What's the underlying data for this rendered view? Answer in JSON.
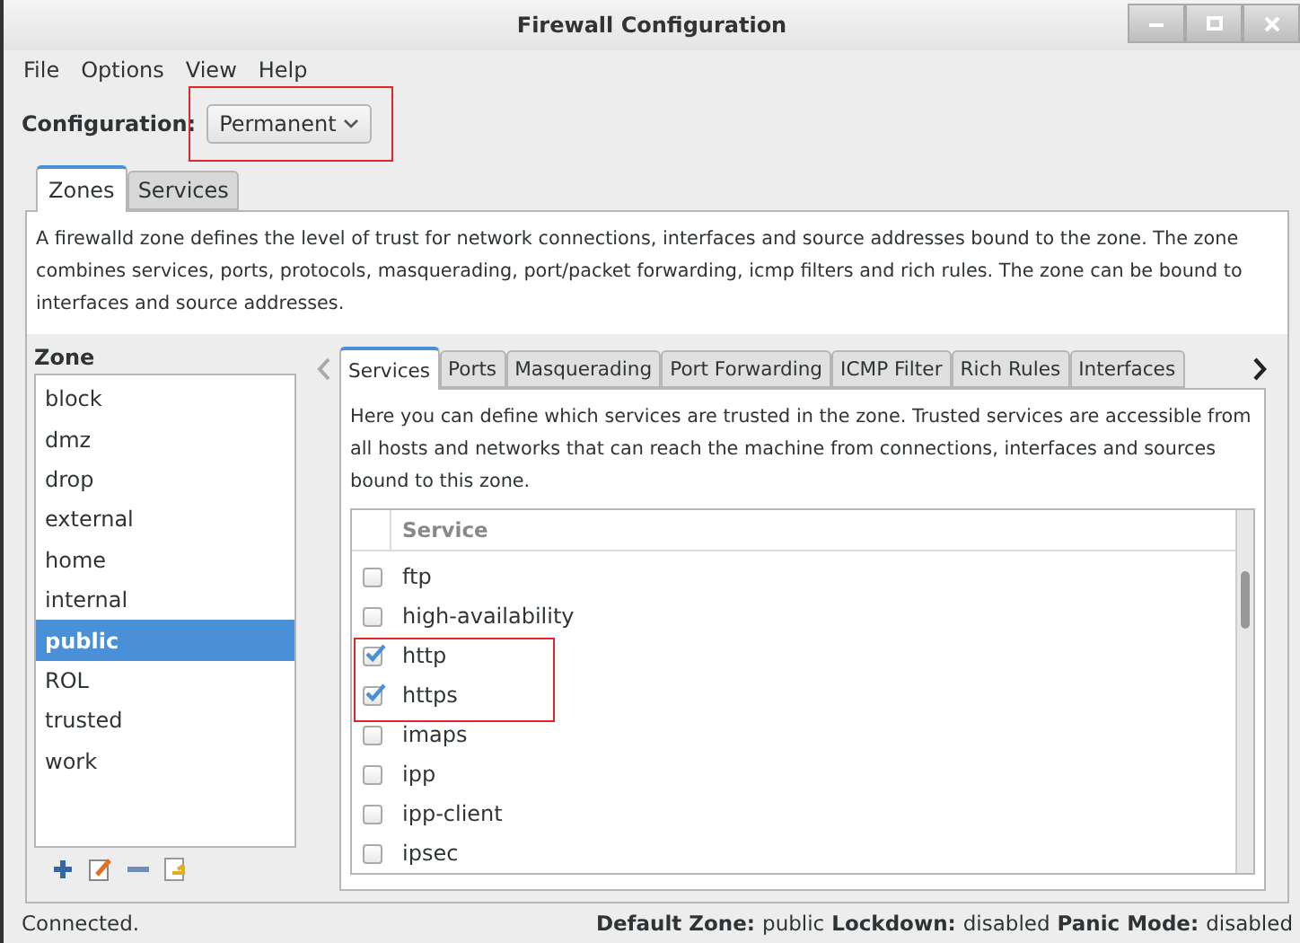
{
  "window": {
    "title": "Firewall Configuration"
  },
  "menu": [
    "File",
    "Options",
    "View",
    "Help"
  ],
  "configuration": {
    "label": "Configuration:",
    "value": "Permanent",
    "highlighted": true
  },
  "main_tabs": [
    {
      "label": "Zones",
      "selected": true
    },
    {
      "label": "Services",
      "selected": false
    }
  ],
  "description": "A firewalld zone defines the level of trust for network connections, interfaces and source addresses bound to the zone. The zone combines services, ports, protocols, masquerading, port/packet forwarding, icmp filters and rich rules. The zone can be bound to interfaces and source addresses.",
  "zone": {
    "label": "Zone",
    "items": [
      {
        "name": "block",
        "selected": false
      },
      {
        "name": "dmz",
        "selected": false
      },
      {
        "name": "drop",
        "selected": false
      },
      {
        "name": "external",
        "selected": false
      },
      {
        "name": "home",
        "selected": false
      },
      {
        "name": "internal",
        "selected": false
      },
      {
        "name": "public",
        "selected": true
      },
      {
        "name": "ROL",
        "selected": false
      },
      {
        "name": "trusted",
        "selected": false
      },
      {
        "name": "work",
        "selected": false
      }
    ]
  },
  "zone_tabs": [
    {
      "label": "Services",
      "selected": true
    },
    {
      "label": "Ports",
      "selected": false
    },
    {
      "label": "Masquerading",
      "selected": false
    },
    {
      "label": "Port Forwarding",
      "selected": false
    },
    {
      "label": "ICMP Filter",
      "selected": false
    },
    {
      "label": "Rich Rules",
      "selected": false
    },
    {
      "label": "Interfaces",
      "selected": false
    }
  ],
  "services": {
    "description": "Here you can define which services are trusted in the zone. Trusted services are accessible from all hosts and networks that can reach the machine from connections, interfaces and sources bound to this zone.",
    "column": "Service",
    "rows": [
      {
        "name": "ftp",
        "checked": false,
        "highlighted": false
      },
      {
        "name": "high-availability",
        "checked": false,
        "highlighted": false
      },
      {
        "name": "http",
        "checked": true,
        "highlighted": true
      },
      {
        "name": "https",
        "checked": true,
        "highlighted": true
      },
      {
        "name": "imaps",
        "checked": false,
        "highlighted": false
      },
      {
        "name": "ipp",
        "checked": false,
        "highlighted": false
      },
      {
        "name": "ipp-client",
        "checked": false,
        "highlighted": false
      },
      {
        "name": "ipsec",
        "checked": false,
        "highlighted": false
      }
    ]
  },
  "status_bar": {
    "message": "Connected.",
    "fields": [
      {
        "label": "Default Zone:",
        "value": "public"
      },
      {
        "label": "Lockdown:",
        "value": "disabled"
      },
      {
        "label": "Panic Mode:",
        "value": "disabled"
      }
    ]
  }
}
